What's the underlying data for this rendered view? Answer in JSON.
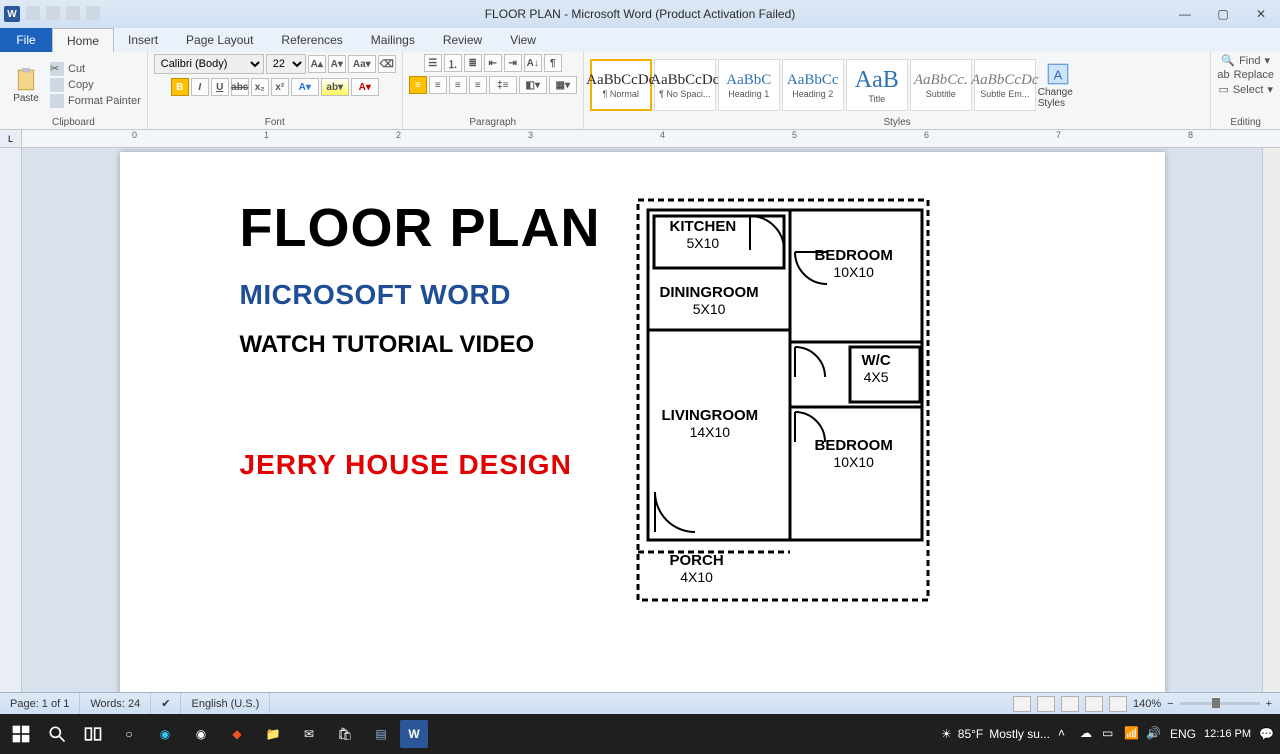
{
  "titlebar": {
    "title": "FLOOR PLAN  -  Microsoft Word (Product Activation Failed)"
  },
  "tabs": {
    "file": "File",
    "home": "Home",
    "insert": "Insert",
    "page": "Page Layout",
    "ref": "References",
    "mail": "Mailings",
    "review": "Review",
    "view": "View"
  },
  "clipboard": {
    "paste": "Paste",
    "cut": "Cut",
    "copy": "Copy",
    "fmt": "Format Painter",
    "label": "Clipboard"
  },
  "font": {
    "name": "Calibri (Body)",
    "size": "22",
    "label": "Font"
  },
  "paragraph": {
    "label": "Paragraph"
  },
  "styles": {
    "label": "Styles",
    "items": [
      {
        "preview": "AaBbCcDc",
        "name": "¶ Normal"
      },
      {
        "preview": "AaBbCcDc",
        "name": "¶ No Spaci..."
      },
      {
        "preview": "AaBbC",
        "name": "Heading 1"
      },
      {
        "preview": "AaBbCc",
        "name": "Heading 2"
      },
      {
        "preview": "AaB",
        "name": "Title"
      },
      {
        "preview": "AaBbCc.",
        "name": "Subtitle"
      },
      {
        "preview": "AaBbCcDc",
        "name": "Subtle Em..."
      }
    ],
    "change": "Change Styles"
  },
  "editing": {
    "find": "Find",
    "replace": "Replace",
    "select": "Select",
    "label": "Editing"
  },
  "document": {
    "title": "FLOOR PLAN",
    "sub1": "MICROSOFT WORD",
    "sub2": "WATCH TUTORIAL VIDEO",
    "author": "JERRY HOUSE DESIGN",
    "rooms": {
      "kitchen": {
        "name": "KITCHEN",
        "size": "5X10"
      },
      "dining": {
        "name": "DININGROOM",
        "size": "5X10"
      },
      "living": {
        "name": "LIVINGROOM",
        "size": "14X10"
      },
      "porch": {
        "name": "PORCH",
        "size": "4X10"
      },
      "bed1": {
        "name": "BEDROOM",
        "size": "10X10"
      },
      "wc": {
        "name": "W/C",
        "size": "4X5"
      },
      "bed2": {
        "name": "BEDROOM",
        "size": "10X10"
      }
    }
  },
  "status": {
    "page": "Page: 1 of 1",
    "words": "Words: 24",
    "lang": "English (U.S.)",
    "zoom": "140%"
  },
  "taskbar": {
    "weather_temp": "85°F",
    "weather_desc": "Mostly su...",
    "lang": "ENG",
    "time": "12:16 PM"
  }
}
